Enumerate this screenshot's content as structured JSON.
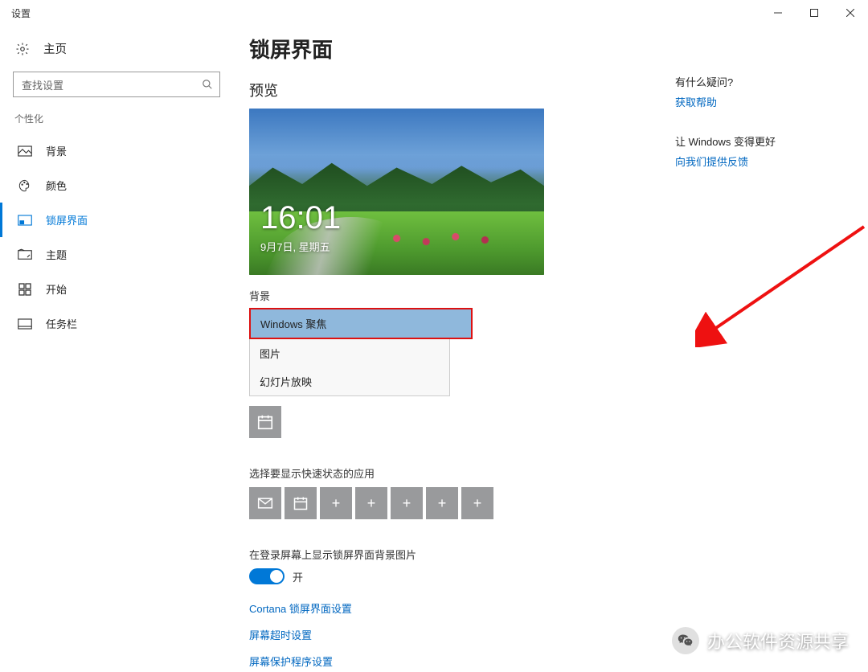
{
  "window": {
    "title": "设置"
  },
  "sidebar": {
    "home_label": "主页",
    "search_placeholder": "查找设置",
    "group_label": "个性化",
    "items": [
      {
        "label": "背景"
      },
      {
        "label": "颜色"
      },
      {
        "label": "锁屏界面"
      },
      {
        "label": "主题"
      },
      {
        "label": "开始"
      },
      {
        "label": "任务栏"
      }
    ]
  },
  "main": {
    "title": "锁屏界面",
    "preview_label": "预览",
    "clock": "16:01",
    "date": "9月7日, 星期五",
    "background_label": "背景",
    "background_options": [
      "Windows 聚焦",
      "图片",
      "幻灯片放映"
    ],
    "quick_status_label": "选择要显示快速状态的应用",
    "show_bg_label": "在登录屏幕上显示锁屏界面背景图片",
    "toggle_state": "开",
    "links": [
      "Cortana 锁屏界面设置",
      "屏幕超时设置",
      "屏幕保护程序设置"
    ]
  },
  "help": {
    "q1": "有什么疑问?",
    "a1": "获取帮助",
    "q2": "让 Windows 变得更好",
    "a2": "向我们提供反馈"
  },
  "watermark": "办公软件资源共享"
}
